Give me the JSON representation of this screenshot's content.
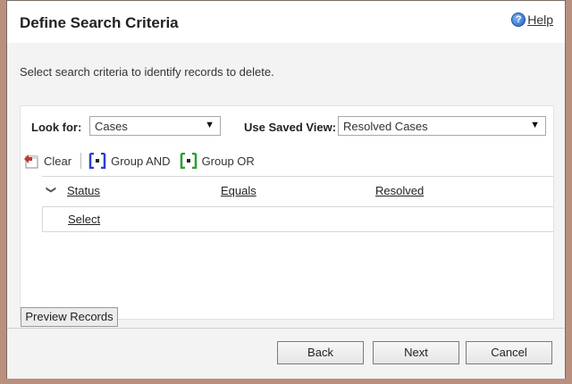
{
  "dialog": {
    "title": "Define Search Criteria",
    "help_label": "Help",
    "description": "Select search criteria to identify records to delete."
  },
  "criteria": {
    "look_for_label": "Look for:",
    "look_for_value": "Cases",
    "saved_view_label": "Use Saved View:",
    "saved_view_value": "Resolved Cases"
  },
  "toolbar": {
    "clear_label": "Clear",
    "group_and_label": "Group AND",
    "group_or_label": "Group OR"
  },
  "grid": {
    "field": "Status",
    "operator": "Equals",
    "value": "Resolved",
    "select_label": "Select"
  },
  "buttons": {
    "preview_label": "Preview Records",
    "back_label": "Back",
    "next_label": "Next",
    "cancel_label": "Cancel"
  },
  "colors": {
    "frame": "#b98f7e",
    "panel_grey": "#f3f3f3",
    "group_and_icon": "#2b3fd1",
    "group_or_icon": "#2aa02a",
    "clear_icon": "#c0392b"
  }
}
